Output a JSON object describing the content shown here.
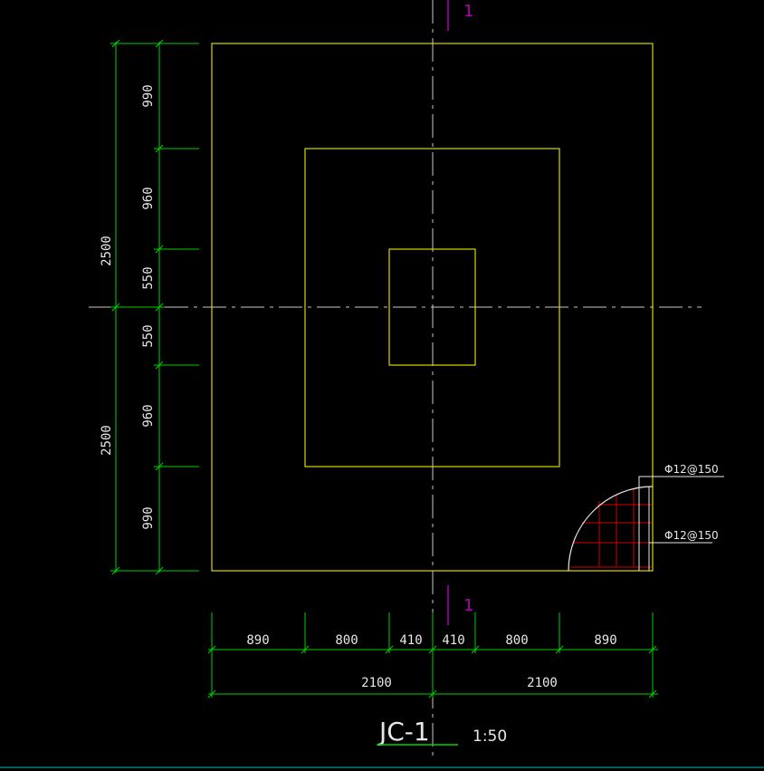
{
  "section_marks": {
    "top": "1",
    "bottom": "1"
  },
  "dimensions": {
    "left_inner": [
      "990",
      "960",
      "550",
      "550",
      "960",
      "990"
    ],
    "left_outer": [
      "2500",
      "2500"
    ],
    "bottom_inner": [
      "890",
      "800",
      "410",
      "410",
      "800",
      "890"
    ],
    "bottom_outer": [
      "2100",
      "2100"
    ]
  },
  "rebar_labels": {
    "upper": "Φ12@150",
    "lower": "Φ12@150"
  },
  "title": {
    "name": "JC-1",
    "scale": "1:50"
  },
  "colors": {
    "outline": "#d8d800",
    "dimension": "#00d000",
    "centerline": "#c8c8c8",
    "section": "#b000b0",
    "rebar": "#d00000",
    "text": "#e8e8e8"
  }
}
